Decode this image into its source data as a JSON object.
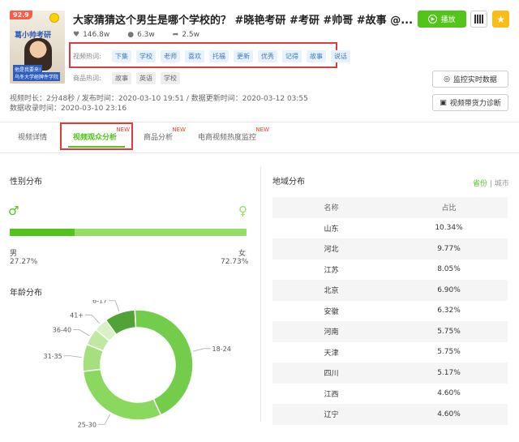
{
  "video": {
    "thumbnail": {
      "score": "92.9",
      "caption_top": "葛小帅考研",
      "caption_mid": "他是我要来!",
      "caption_bottom": "乌冬大学砸牌件学院"
    },
    "title": "大家猜猜这个男生是哪个学校的？ #晓艳考研 #考研 #帅哥 #故事 @...",
    "stats": {
      "likes": "146.8w",
      "comments": "6.3w",
      "shares": "2.5w"
    },
    "hot_words_label": "视频热词:",
    "hot_words": [
      "下集",
      "学校",
      "老师",
      "喜欢",
      "托福",
      "更新",
      "优秀",
      "记得",
      "故事",
      "说话"
    ],
    "product_words_label": "商品热词:",
    "product_words": [
      "故事",
      "英语",
      "学校"
    ],
    "meta_line1": "视频时长：2分48秒 / 发布时间：2020-03-10 19:51 / 数据更新时间：2020-03-12 03:55",
    "meta_line2": "数据收录时间：2020-03-10 23:16"
  },
  "actions": {
    "play_label": "播放",
    "monitor_label": "监控实时数据",
    "diagnose_label": "视频带货力诊断"
  },
  "tabs": [
    {
      "label": "视频详情",
      "new": ""
    },
    {
      "label": "视频观众分析",
      "new": "NEW"
    },
    {
      "label": "商品分析",
      "new": "NEW"
    },
    {
      "label": "电商视频热度监控",
      "new": "NEW"
    }
  ],
  "gender": {
    "title": "性别分布",
    "male_label": "男",
    "male_pct": "27.27%",
    "male_fraction": 0.2727,
    "female_label": "女",
    "female_pct": "72.73%"
  },
  "age": {
    "title": "年龄分布",
    "segments": [
      {
        "label": "6-17",
        "value": 9,
        "color": "#52a336"
      },
      {
        "label": "18-24",
        "value": 44,
        "color": "#73cd4b"
      },
      {
        "label": "25-30",
        "value": 30,
        "color": "#8bd85f"
      },
      {
        "label": "31-35",
        "value": 8,
        "color": "#a6e07e"
      },
      {
        "label": "36-40",
        "value": 5,
        "color": "#bfe9a1"
      },
      {
        "label": "41+",
        "value": 4,
        "color": "#d8f2c4"
      }
    ]
  },
  "region": {
    "title": "地域分布",
    "switch_on": "省份",
    "switch_sep": " | ",
    "switch_off": "城市",
    "col_name": "名称",
    "col_ratio": "占比",
    "rows": [
      {
        "name": "山东",
        "ratio": "10.34%"
      },
      {
        "name": "河北",
        "ratio": "9.77%"
      },
      {
        "name": "江苏",
        "ratio": "8.05%"
      },
      {
        "name": "北京",
        "ratio": "6.90%"
      },
      {
        "name": "安徽",
        "ratio": "6.32%"
      },
      {
        "name": "河南",
        "ratio": "5.75%"
      },
      {
        "name": "天津",
        "ratio": "5.75%"
      },
      {
        "name": "四川",
        "ratio": "5.17%"
      },
      {
        "name": "江西",
        "ratio": "4.60%"
      },
      {
        "name": "辽宁",
        "ratio": "4.60%"
      }
    ]
  }
}
